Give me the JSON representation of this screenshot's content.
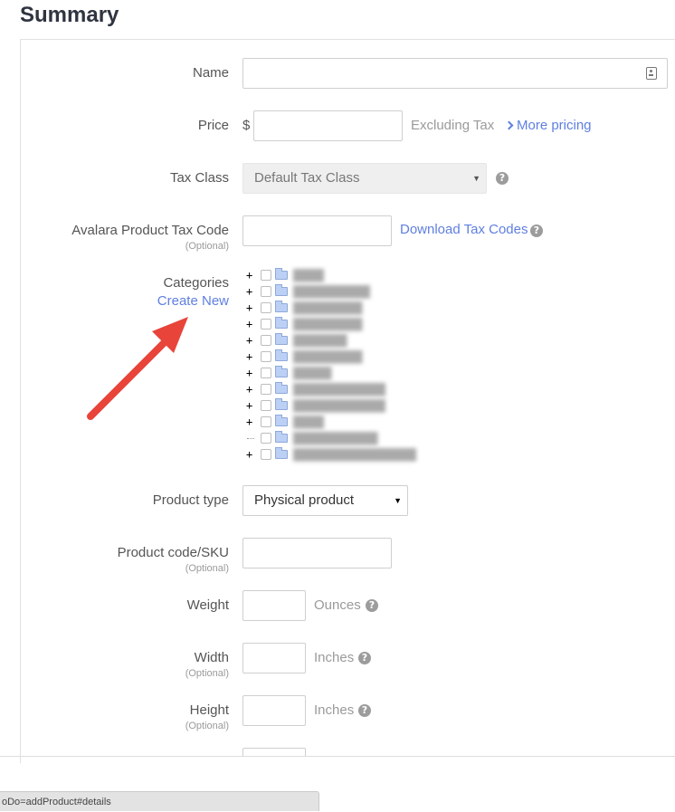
{
  "page": {
    "title": "Summary"
  },
  "form": {
    "name": {
      "label": "Name",
      "value": ""
    },
    "price": {
      "label": "Price",
      "currency": "$",
      "value": "",
      "note": "Excluding Tax",
      "more_link": "More pricing"
    },
    "tax_class": {
      "label": "Tax Class",
      "selected": "Default Tax Class",
      "help": "?"
    },
    "avalara": {
      "label": "Avalara Product Tax Code",
      "optional": "(Optional)",
      "value": "",
      "link": "Download Tax Codes",
      "help": "?"
    },
    "categories": {
      "label": "Categories",
      "create_new": "Create New",
      "tree_rows": 12
    },
    "product_type": {
      "label": "Product type",
      "selected": "Physical product"
    },
    "sku": {
      "label": "Product code/SKU",
      "optional": "(Optional)",
      "value": ""
    },
    "weight": {
      "label": "Weight",
      "value": "",
      "unit": "Ounces",
      "help": "?"
    },
    "width": {
      "label": "Width",
      "optional": "(Optional)",
      "value": "",
      "unit": "Inches",
      "help": "?"
    },
    "height": {
      "label": "Height",
      "optional": "(Optional)",
      "value": "",
      "unit": "Inches",
      "help": "?"
    }
  },
  "status_bar": {
    "url": "oDo=addProduct#details"
  },
  "colors": {
    "link": "#5f7fe0",
    "arrow": "#e8443a",
    "folder": "#bcd0f5"
  }
}
